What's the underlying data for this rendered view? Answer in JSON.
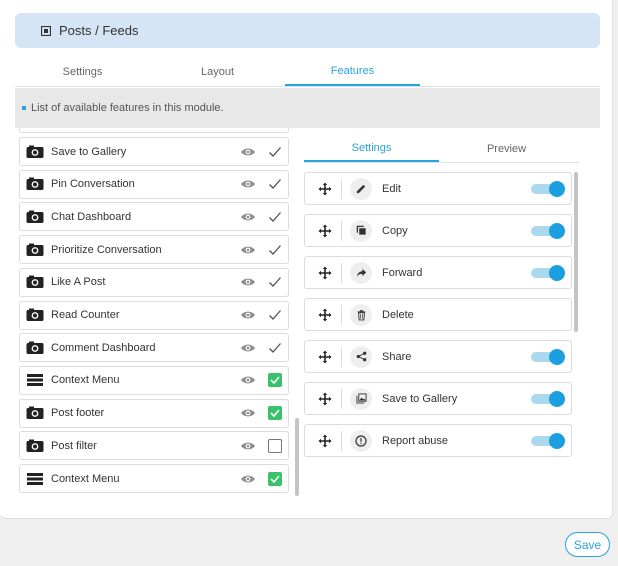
{
  "module": {
    "title": "Posts / Feeds",
    "icon": "module-icon"
  },
  "top_tabs": [
    {
      "label": "Settings",
      "active": false
    },
    {
      "label": "Layout",
      "active": false
    },
    {
      "label": "Features",
      "active": true
    }
  ],
  "info": {
    "text": "List of available features in this module."
  },
  "features_list": [
    {
      "label": "Save to Gallery",
      "icon": "camera-icon",
      "check": "tick"
    },
    {
      "label": "Pin Conversation",
      "icon": "camera-icon",
      "check": "tick"
    },
    {
      "label": "Chat Dashboard",
      "icon": "camera-icon",
      "check": "tick"
    },
    {
      "label": "Prioritize Conversation",
      "icon": "camera-icon",
      "check": "tick"
    },
    {
      "label": "Like A Post",
      "icon": "camera-icon",
      "check": "tick"
    },
    {
      "label": "Read Counter",
      "icon": "camera-icon",
      "check": "tick"
    },
    {
      "label": "Comment Dashboard",
      "icon": "camera-icon",
      "check": "tick"
    },
    {
      "label": "Context Menu",
      "icon": "menu-icon",
      "check": "checked"
    },
    {
      "label": "Post footer",
      "icon": "camera-icon",
      "check": "checked"
    },
    {
      "label": "Post filter",
      "icon": "camera-icon",
      "check": "unchecked"
    },
    {
      "label": "Context Menu",
      "icon": "menu-icon",
      "check": "checked"
    }
  ],
  "right_tabs": [
    {
      "label": "Settings",
      "active": true
    },
    {
      "label": "Preview",
      "active": false
    }
  ],
  "actions": [
    {
      "label": "Edit",
      "icon": "pencil-icon",
      "toggle": true
    },
    {
      "label": "Copy",
      "icon": "copy-icon",
      "toggle": true
    },
    {
      "label": "Forward",
      "icon": "forward-icon",
      "toggle": true
    },
    {
      "label": "Delete",
      "icon": "trash-icon",
      "toggle": false
    },
    {
      "label": "Share",
      "icon": "share-icon",
      "toggle": true
    },
    {
      "label": "Save to Gallery",
      "icon": "gallery-icon",
      "toggle": true
    },
    {
      "label": "Report abuse",
      "icon": "alert-icon",
      "toggle": true
    }
  ],
  "save": {
    "label": "Save"
  },
  "colors": {
    "accent": "#29a3d9",
    "toggle_on": "#1c9fe0",
    "check_green": "#3ac26b",
    "header_bg": "#d6e5f5"
  }
}
